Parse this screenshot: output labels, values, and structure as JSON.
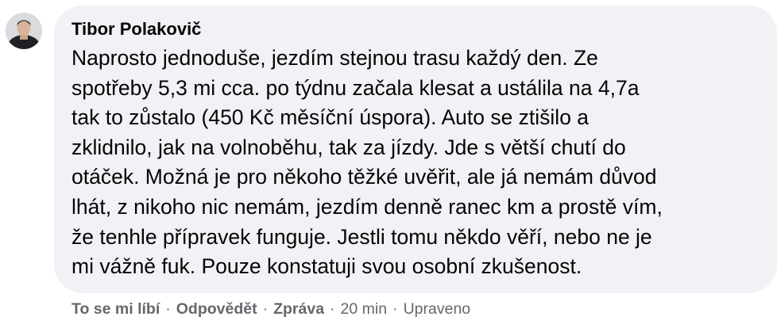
{
  "comment": {
    "author": "Tibor Polakovič",
    "text_lines": [
      "Naprosto jednoduše, jezdím stejnou trasu každý den. Ze",
      "spotřeby 5,3 mi cca. po týdnu začala klesat a ustálila na 4,7a",
      "tak to zůstalo (450 Kč měsíční úspora). Auto se ztišilo a",
      "zklidnilo, jak na volnoběhu, tak za jízdy. Jde s větší chutí do",
      "otáček. Možná je pro někoho těžké uvěřit, ale já nemám důvod",
      "lhát, z nikoho nic nemám, jezdím denně ranec km a prostě vím,",
      "že tenhle přípravek funguje. Jestli tomu někdo věří, nebo ne je",
      "mi vážně fuk. Pouze konstatuji svou osobní zkušenost."
    ]
  },
  "actions": {
    "like_label": "To se mi líbí",
    "reply_label": "Odpovědět",
    "message_label": "Zpráva",
    "time": "20 min",
    "edited": "Upraveno",
    "separator": "·"
  },
  "colors": {
    "bubble_bg": "#f0f2f5",
    "text": "#050505",
    "secondary_text": "#65676b"
  },
  "icons": {
    "avatar": "profile-photo"
  }
}
